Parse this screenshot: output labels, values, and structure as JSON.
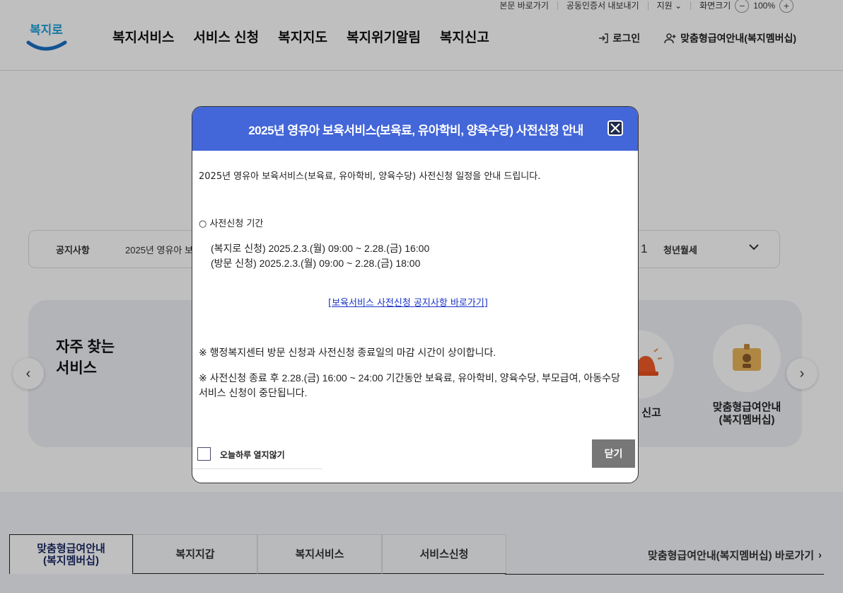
{
  "utility": {
    "skip_link": "본문 바로가기",
    "cert_export": "공동인증서 내보내기",
    "support": "지원",
    "screen_size": "화면크기",
    "zoom_level": "100%"
  },
  "header": {
    "logo_text": "복지로",
    "nav": [
      "복지서비스",
      "서비스 신청",
      "복지지도",
      "복지위기알림",
      "복지신고"
    ],
    "login": "로그인",
    "membership": "맞춤형급여안내(복지멤버십)"
  },
  "notice": {
    "label": "공지사항",
    "text": "2025년 영유아 보",
    "number": "1",
    "category": "청년월세"
  },
  "frequent": {
    "title": "자주 찾는\n서비스",
    "items": [
      "신고",
      "맞춤형급여안내\n(복지멤버십)"
    ]
  },
  "bottom_tabs": {
    "tabs": [
      "맞춤형급여안내\n(복지멤버십)",
      "복지지갑",
      "복지서비스",
      "서비스신청"
    ],
    "goto": "맞춤형급여안내(복지멤버십) 바로가기"
  },
  "modal": {
    "title": "2025년 영유아 보육서비스(보육료, 유아학비, 양육수당) 사전신청 안내",
    "intro": "2025년 영유아 보육서비스(보육료, 유아학비, 양육수당) 사전신청 일정을 안내 드립니다.",
    "period_title": "○ 사전신청 기간",
    "schedule_online": "(복지로 신청) 2025.2.3.(월) 09:00 ~ 2.28.(금) 16:00",
    "schedule_visit": "(방문 신청) 2025.2.3.(월) 09:00 ~ 2.28.(금) 18:00",
    "link": "[보육서비스 사전신청 공지사항 바로가기]",
    "note1": "※ 행정복지센터 방문 신청과 사전신청 종료일의 마감 시간이 상이합니다.",
    "note2": "※ 사전신청 종료 후 2.28.(금) 16:00 ~ 24:00 기간동안 보육료, 유아학비, 양육수당, 부모급여, 아동수당 서비스 신청이 중단됩니다.",
    "no_show_today": "오늘하루 열지않기",
    "close_button": "닫기"
  },
  "colors": {
    "modal_header": "#4366d8",
    "link": "#1a33c6",
    "logo": "#1fa0d8"
  }
}
